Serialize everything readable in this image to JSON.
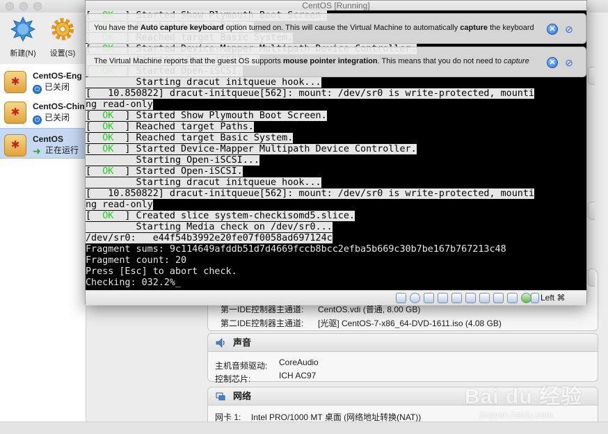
{
  "manager": {
    "toolbar": {
      "new_label": "新建(N)",
      "settings_label": "设置(S)"
    },
    "vms": [
      {
        "name": "CentOS-Eng",
        "state": "已关闭",
        "state_type": "off"
      },
      {
        "name": "CentOS-Chin",
        "state": "已关闭",
        "state_type": "off"
      },
      {
        "name": "CentOS",
        "state": "正在运行",
        "state_type": "running"
      }
    ],
    "storage": {
      "primary_ide_label": "第一IDE控制器主通道:",
      "primary_ide_value": "CentOS.vdi (普通, 8.00 GB)",
      "secondary_ide_label": "第二IDE控制器主通道:",
      "secondary_ide_value": "[光驱] CentOS-7-x86_64-DVD-1611.iso (4.08 GB)"
    },
    "audio": {
      "title": "声音",
      "driver_label": "主机音频驱动:",
      "driver_value": "CoreAudio",
      "chip_label": "控制芯片:",
      "chip_value": "ICH AC97"
    },
    "network": {
      "title": "网络",
      "adapter_label": "网卡 1:",
      "adapter_value": "Intel PRO/1000 MT 桌面 (网络地址转换(NAT))"
    }
  },
  "vm_window": {
    "title": "CentOS [Running]",
    "notices": {
      "keyboard": {
        "pre": "You have the ",
        "bold1": "Auto capture keyboard",
        "mid": " option turned on. This will cause the Virtual Machine to automatically ",
        "bold2": "capture",
        "post": " the keyboard"
      },
      "mouse": {
        "pre": "The Virtual Machine reports that the guest OS supports ",
        "bold1": "mouse pointer integration",
        "mid": ". This means that you do not need to ",
        "italic": "capture"
      }
    },
    "console_lines": [
      {
        "kind": "ok",
        "pre": "[  ",
        "status": "OK",
        "post": "  ] Started Show Plymouth Boot Screen."
      },
      {
        "kind": "ok",
        "pre": "[  ",
        "status": "OK",
        "post": "  ] Reached target Paths."
      },
      {
        "kind": "ok",
        "pre": "[  ",
        "status": "OK",
        "post": "  ] Reached target Basic System."
      },
      {
        "kind": "ok",
        "pre": "[  ",
        "status": "OK",
        "post": "  ] Started Device-Mapper Multipath Device Controller."
      },
      {
        "kind": "hl",
        "text": "         Starting Open-iSCSI..."
      },
      {
        "kind": "ok",
        "pre": "[  ",
        "status": "OK",
        "post": "  ] Started Open-iSCSI."
      },
      {
        "kind": "hl",
        "text": "         Starting dracut initqueue hook..."
      },
      {
        "kind": "hl",
        "text": "[   10.850822] dracut-initqueue[562]: mount: /dev/sr0 is write-protected, mounti"
      },
      {
        "kind": "hl",
        "text": "ng read-only"
      },
      {
        "kind": "ok",
        "pre": "[  ",
        "status": "OK",
        "post": "  ] Started Show Plymouth Boot Screen."
      },
      {
        "kind": "ok",
        "pre": "[  ",
        "status": "OK",
        "post": "  ] Reached target Paths."
      },
      {
        "kind": "ok",
        "pre": "[  ",
        "status": "OK",
        "post": "  ] Reached target Basic System."
      },
      {
        "kind": "ok",
        "pre": "[  ",
        "status": "OK",
        "post": "  ] Started Device-Mapper Multipath Device Controller."
      },
      {
        "kind": "hl",
        "text": "         Starting Open-iSCSI..."
      },
      {
        "kind": "ok",
        "pre": "[  ",
        "status": "OK",
        "post": "  ] Started Open-iSCSI."
      },
      {
        "kind": "hl",
        "text": "         Starting dracut initqueue hook..."
      },
      {
        "kind": "hl",
        "text": "[   10.850822] dracut-initqueue[562]: mount: /dev/sr0 is write-protected, mounti"
      },
      {
        "kind": "hl",
        "text": "ng read-only"
      },
      {
        "kind": "ok",
        "pre": "[  ",
        "status": "OK",
        "post": "  ] Created slice system-checkisomd5.slice."
      },
      {
        "kind": "hl",
        "text": "         Starting Media check on /dev/sr0..."
      },
      {
        "kind": "hl",
        "text": "/dev/sr0:   e44f54b3992e20fe07f0058ad697124c"
      },
      {
        "kind": "plain",
        "text": "Fragment sums: 9c114649afddb51d7d4669fccb8bcc2efba5b669c30b7be167b767213c48"
      },
      {
        "kind": "plain",
        "text": "Fragment count: 20"
      },
      {
        "kind": "plain",
        "text": "Press [Esc] to abort check."
      },
      {
        "kind": "plain",
        "text": "Checking: 032.2%_"
      }
    ],
    "host_key": "Left ⌘"
  },
  "watermark": {
    "main": "Bai du 经验",
    "sub": "jingyan.baidu.com"
  },
  "colors": {
    "ok_green": "#2fc82f",
    "console_bg": "#000000",
    "highlight_bg": "#e6e6e6",
    "selection_blue": "#c7d9f2"
  }
}
